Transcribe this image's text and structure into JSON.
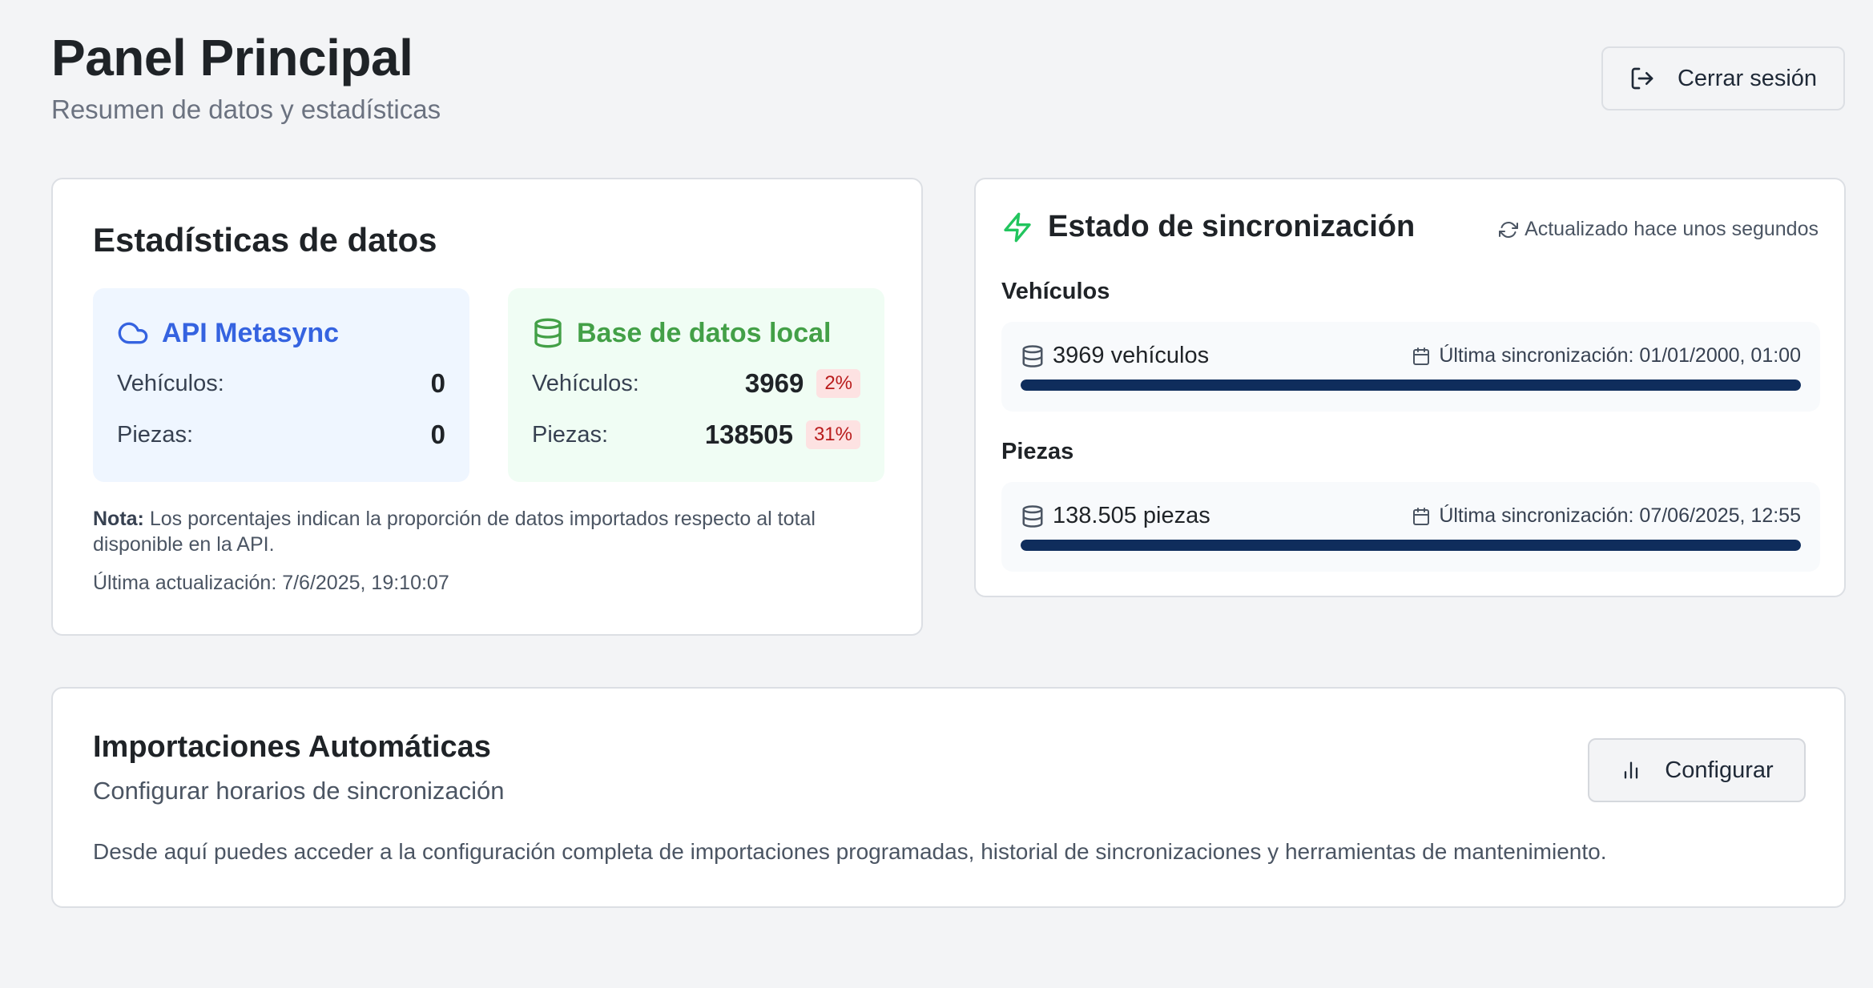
{
  "header": {
    "title": "Panel Principal",
    "subtitle": "Resumen de datos y estadísticas",
    "logout_label": "Cerrar sesión"
  },
  "stats": {
    "title": "Estadísticas de datos",
    "api": {
      "name": "API Metasync",
      "vehicles_label": "Vehículos:",
      "vehicles_value": "0",
      "parts_label": "Piezas:",
      "parts_value": "0"
    },
    "local": {
      "name": "Base de datos local",
      "vehicles_label": "Vehículos:",
      "vehicles_value": "3969",
      "vehicles_pct": "2%",
      "parts_label": "Piezas:",
      "parts_value": "138505",
      "parts_pct": "31%"
    },
    "note_label": "Nota:",
    "note_text": "Los porcentajes indican la proporción de datos importados respecto al total disponible en la API.",
    "last_update": "Última actualización: 7/6/2025, 19:10:07"
  },
  "sync": {
    "title": "Estado de sincronización",
    "updated": "Actualizado hace unos segundos",
    "vehicles": {
      "label": "Vehículos",
      "count": "3969 vehículos",
      "last_sync": "Última sincronización: 01/01/2000, 01:00",
      "progress": 1.0
    },
    "parts": {
      "label": "Piezas",
      "count": "138.505 piezas",
      "last_sync": "Última sincronización: 07/06/2025, 12:55",
      "progress": 1.0
    }
  },
  "imports": {
    "title": "Importaciones Automáticas",
    "subtitle": "Configurar horarios de sincronización",
    "description": "Desde aquí puedes acceder a la configuración completa de importaciones programadas, historial de sincronizaciones y herramientas de mantenimiento.",
    "config_label": "Configurar"
  },
  "icons": {
    "logout": "logout-icon",
    "cloud": "cloud-icon",
    "database": "database-icon",
    "zap": "zap-icon",
    "refresh": "refresh-icon",
    "calendar": "calendar-icon",
    "bar_chart": "bar-chart-icon"
  },
  "colors": {
    "api_accent": "#3563e0",
    "local_accent": "#43a047",
    "sync_accent": "#22c55e",
    "progress": "#0f2d5c",
    "badge_bg": "#fde2e2",
    "badge_text": "#b91c1c"
  }
}
